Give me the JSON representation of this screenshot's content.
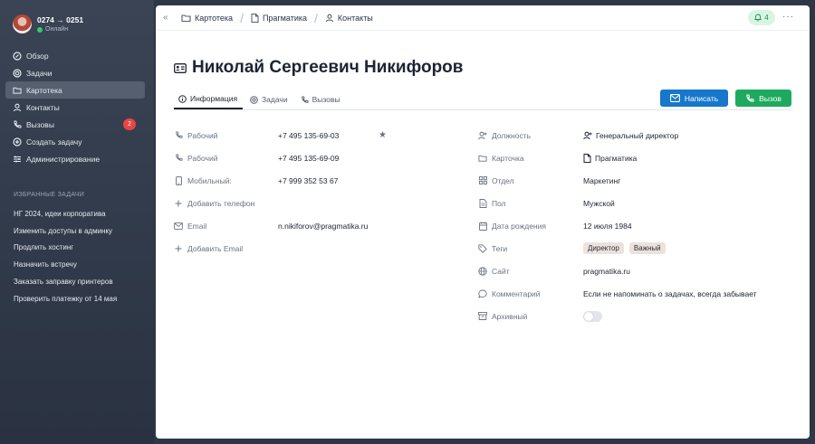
{
  "user": {
    "name": "0274 → 0251",
    "status": "Онлайн"
  },
  "nav": [
    {
      "label": "Обзор",
      "icon": "grid-icon"
    },
    {
      "label": "Задачи",
      "icon": "target-icon"
    },
    {
      "label": "Картотека",
      "icon": "folder-icon",
      "active": true
    },
    {
      "label": "Контакты",
      "icon": "user-icon"
    },
    {
      "label": "Вызовы",
      "icon": "phone-icon",
      "badge": "2"
    },
    {
      "label": "Создать задачу",
      "icon": "plus-circle-icon"
    },
    {
      "label": "Администрирование",
      "icon": "sliders-icon"
    }
  ],
  "favorites": {
    "title": "ИЗБРАННЫЕ ЗАДАЧИ",
    "items": [
      "НГ 2024, идеи корпоратива",
      "Изменить доступы в админку",
      "Продлить хостинг",
      "Назначить встречу",
      "Заказать заправку принтеров",
      "Проверить платежку от 14 мая"
    ]
  },
  "breadcrumb": [
    "Картотека",
    "Прагматика",
    "Контакты"
  ],
  "notifications": "4",
  "title": "Николай Сергеевич Никифоров",
  "tabs": [
    "Информация",
    "Задачи",
    "Вызовы"
  ],
  "buttons": {
    "write": "Написать",
    "call": "Вызов"
  },
  "contacts": [
    {
      "label": "Рабочий",
      "value": "+7 495 135-69-03",
      "starred": true
    },
    {
      "label": "Рабочий",
      "value": "+7 495 135-69-09"
    },
    {
      "label": "Мобильный:",
      "value": "+7 999 352 53 67"
    },
    {
      "label": "Добавить телефон",
      "value": ""
    },
    {
      "label": "Email",
      "value": "n.nikiforov@pragmatika.ru"
    },
    {
      "label": "Добавить Email",
      "value": ""
    }
  ],
  "details": {
    "position": {
      "label": "Должность",
      "value": "Генеральный директор"
    },
    "card": {
      "label": "Карточка",
      "value": "Прагматика"
    },
    "department": {
      "label": "Отдел",
      "value": "Маркетинг"
    },
    "gender": {
      "label": "Пол",
      "value": "Мужской"
    },
    "birthday": {
      "label": "Дата рождения",
      "value": "12 июля 1984"
    },
    "tags": {
      "label": "Теги",
      "values": [
        "Директор",
        "Важный"
      ]
    },
    "site": {
      "label": "Сайт",
      "value": "pragmatika.ru"
    },
    "comment": {
      "label": "Комментарий",
      "value": "Если не напоминать о задачах, всегда забывает"
    },
    "archived": {
      "label": "Архивный",
      "value": false
    }
  },
  "colors": {
    "accent_blue": "#1677cc",
    "accent_green": "#1eaa5e",
    "badge_red": "#e84545"
  }
}
